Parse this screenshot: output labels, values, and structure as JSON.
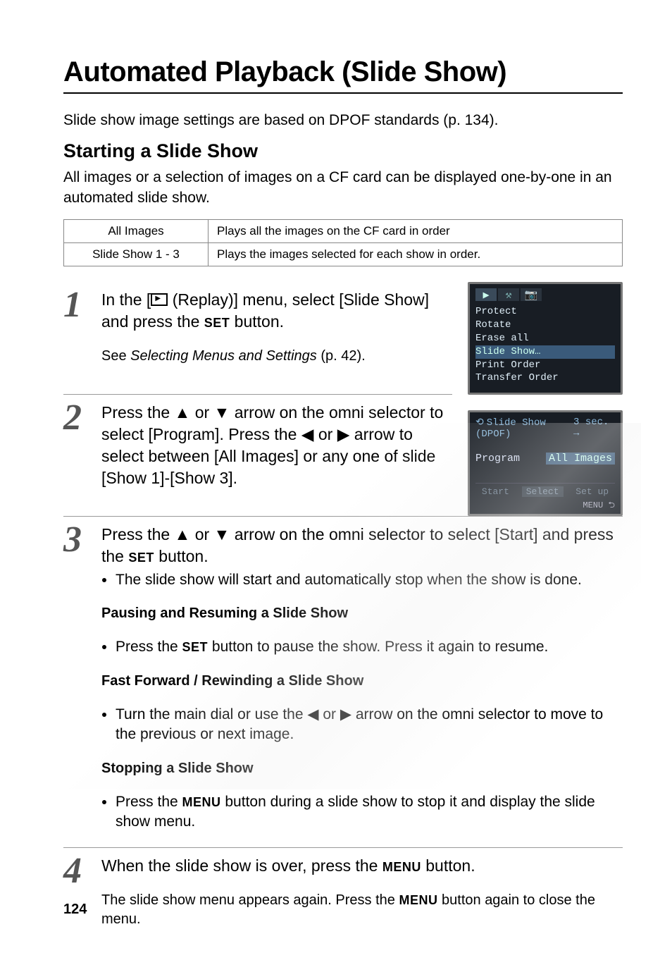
{
  "title": "Automated Playback (Slide Show)",
  "intro": "Slide show image settings are based on DPOF standards (p. 134).",
  "section": {
    "heading": "Starting a Slide Show",
    "body": "All images or a selection of images on a CF card can be displayed one-by-one in an automated slide show."
  },
  "options_table": {
    "rows": [
      {
        "label": "All Images",
        "desc": "Plays all the images on the CF card in order"
      },
      {
        "label": "Slide Show 1 - 3",
        "desc": "Plays the images selected for each show in order."
      }
    ]
  },
  "steps": [
    {
      "num": "1",
      "lead_pre": "In the [",
      "lead_icon": "replay-icon",
      "lead_mid": " (Replay)] menu, select [Slide Show] and press the ",
      "lead_btn": "SET",
      "lead_post": " button.",
      "sub": "See Selecting Menus and Settings (p. 42).",
      "sub_italic_part": "Selecting Menus and Settings"
    },
    {
      "num": "2",
      "text_parts": [
        "Press the ",
        "▲",
        " or ",
        "▼",
        " arrow on the omni selector to select [Program]. Press the ",
        "◀",
        " or ",
        "▶",
        " arrow to select between [All Images] or any one of slide [Show 1]-[Show 3]."
      ]
    },
    {
      "num": "3",
      "lead_parts": [
        "Press the ",
        "▲",
        " or ",
        "▼",
        " arrow on the omni selector to select [Start] and press the ",
        "SET",
        " button."
      ],
      "bullet1": "The slide show will start and automatically stop when the show is done.",
      "sub1_heading": "Pausing and Resuming a Slide Show",
      "sub1_bullet_pre": "Press the ",
      "sub1_bullet_btn": "SET",
      "sub1_bullet_post": " button to pause the show. Press it again to resume.",
      "sub2_heading": "Fast Forward / Rewinding a Slide Show",
      "sub2_bullet_pre": "Turn the main dial or use the ",
      "sub2_bullet_mid": " or ",
      "sub2_bullet_post": " arrow on the omni selector to move to the previous or next image.",
      "sub3_heading": "Stopping a Slide Show",
      "sub3_bullet_pre": "Press the ",
      "sub3_bullet_btn": "MENU",
      "sub3_bullet_post": " button during a slide show to stop it and display the slide show menu."
    },
    {
      "num": "4",
      "lead_pre": "When the slide show is over, press the ",
      "lead_btn": "MENU",
      "lead_post": " button.",
      "sub_pre": "The slide show menu appears again. Press the ",
      "sub_btn": "MENU",
      "sub_post": " button again to close the menu."
    }
  ],
  "screen1": {
    "items": [
      "Protect",
      "Rotate",
      "Erase all",
      "Slide Show…",
      "Print Order",
      "Transfer Order"
    ],
    "highlight_index": 3
  },
  "screen2": {
    "header_left": "Slide Show (DPOF)",
    "header_right": "3 sec. →",
    "body_left": "Program",
    "body_right": "All Images",
    "footer": [
      "Start",
      "Select",
      "Set up"
    ],
    "menu": "MENU ⮌"
  },
  "page_number": "124"
}
